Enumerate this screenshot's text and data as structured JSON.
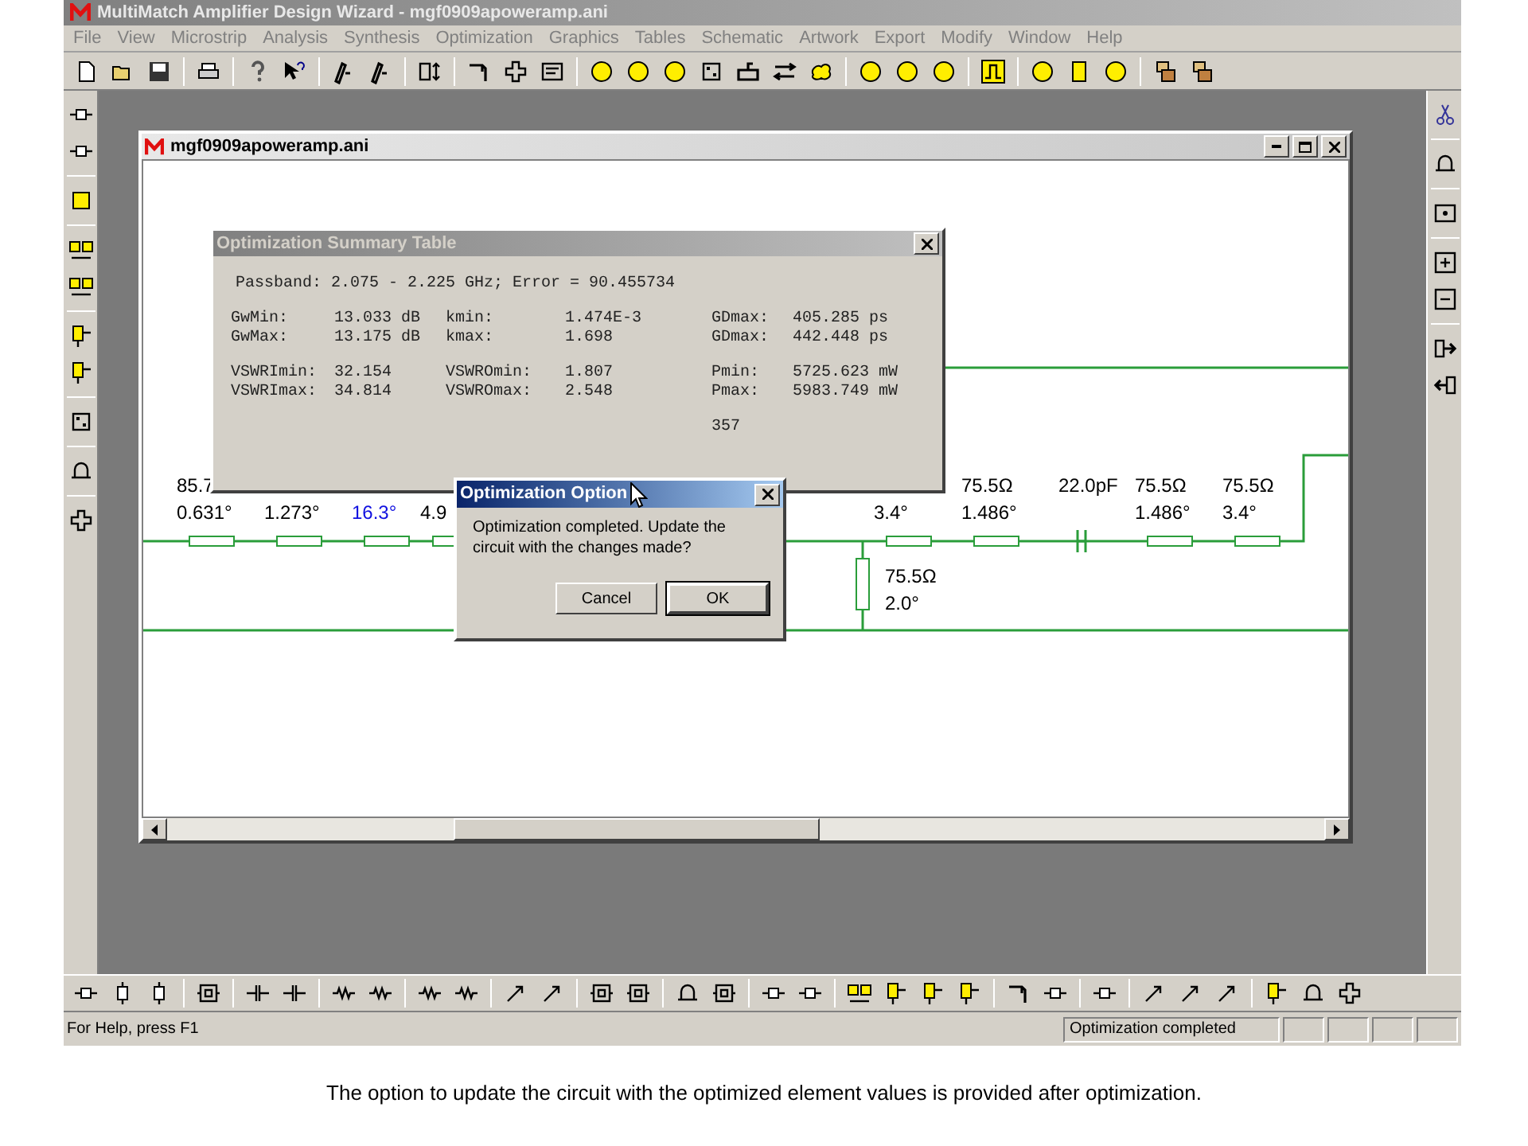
{
  "app": {
    "title": "MultiMatch Amplifier Design Wizard - mgf0909apoweramp.ani"
  },
  "menu": [
    "File",
    "View",
    "Microstrip",
    "Analysis",
    "Synthesis",
    "Optimization",
    "Graphics",
    "Tables",
    "Schematic",
    "Artwork",
    "Export",
    "Modify",
    "Window",
    "Help"
  ],
  "document": {
    "title": "mgf0909apoweramp.ani"
  },
  "circuit": {
    "series": [
      {
        "kind": "line",
        "value": "85.7",
        "angle": "0.631°",
        "highlighted": false
      },
      {
        "kind": "line",
        "angle": "1.273°",
        "highlighted": false
      },
      {
        "kind": "line",
        "angle": "16.3°",
        "highlighted": true
      },
      {
        "kind": "line",
        "angle": "4.9",
        "highlighted": false
      },
      {
        "kind": "line",
        "angle": "3.4°",
        "highlighted": false
      },
      {
        "kind": "line",
        "value": "75.5Ω",
        "angle": "1.486°",
        "highlighted": false
      },
      {
        "kind": "capacitor",
        "value": "22.0pF",
        "highlighted": false
      },
      {
        "kind": "line",
        "value": "75.5Ω",
        "angle": "1.486°",
        "highlighted": false
      },
      {
        "kind": "line",
        "value": "75.5Ω",
        "angle": "3.4°",
        "highlighted": false
      }
    ],
    "stub": {
      "value": "75.5Ω",
      "angle": "2.0°"
    }
  },
  "summary_dialog": {
    "title": "Optimization Summary Table",
    "passband": "Passband: 2.075 - 2.225 GHz; Error = 90.455734",
    "groups": [
      {
        "rows": [
          {
            "cells": [
              {
                "label": "GwMin:",
                "value": "13.033 dB"
              },
              {
                "label": "kmin:",
                "value": "1.474E-3"
              },
              {
                "label": "GDmax:",
                "value": "405.285 ps"
              }
            ]
          },
          {
            "cells": [
              {
                "label": "GwMax:",
                "value": "13.175 dB"
              },
              {
                "label": "kmax:",
                "value": "1.698"
              },
              {
                "label": "GDmax:",
                "value": "442.448 ps"
              }
            ]
          }
        ]
      },
      {
        "rows": [
          {
            "cells": [
              {
                "label": "VSWRImin:",
                "value": "32.154"
              },
              {
                "label": "VSWROmin:",
                "value": "1.807"
              },
              {
                "label": "Pmin:",
                "value": "5725.623 mW"
              }
            ]
          },
          {
            "cells": [
              {
                "label": "VSWRImax:",
                "value": "34.814"
              },
              {
                "label": "VSWROmax:",
                "value": "2.548"
              },
              {
                "label": "Pmax:",
                "value": "5983.749 mW"
              }
            ]
          }
        ]
      }
    ],
    "count": "357"
  },
  "option_dialog": {
    "title": "Optimization Option",
    "message": "Optimization completed. Update the circuit with the changes made?",
    "buttons": [
      {
        "label": "Cancel",
        "default": false
      },
      {
        "label": "OK",
        "default": true
      }
    ]
  },
  "status_bar": {
    "help": "For Help, press F1",
    "message": "Optimization completed"
  },
  "caption": "The option to update the circuit with the optimized element values is provided after optimization."
}
